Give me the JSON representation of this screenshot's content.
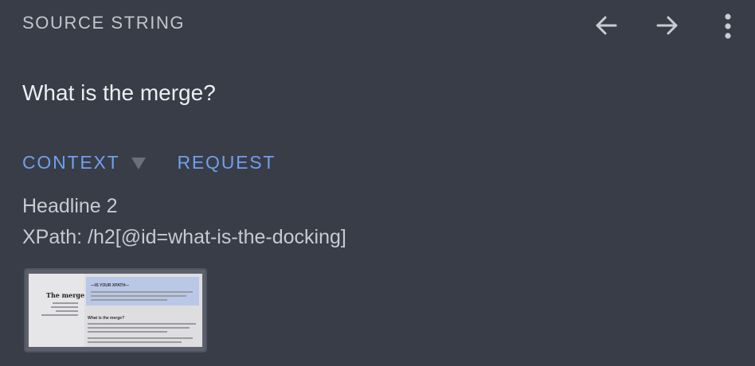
{
  "header": {
    "label": "SOURCE STRING",
    "icons": [
      "arrow-left-icon",
      "arrow-right-icon",
      "more-vert-icon"
    ]
  },
  "source": {
    "text": "What is the merge?"
  },
  "tabs": {
    "context_label": "CONTEXT",
    "request_label": "REQUEST"
  },
  "context": {
    "element_type": "Headline 2",
    "xpath": "XPath: /h2[@id=what-is-the-docking]"
  },
  "screenshot": {
    "title": "The merge",
    "banner_heading": "—IS YOUR XPATH—",
    "section_heading": "What is the merge?"
  },
  "colors": {
    "background": "#393d48",
    "accent": "#6fa0ec",
    "muted": "#c3c6cd"
  }
}
